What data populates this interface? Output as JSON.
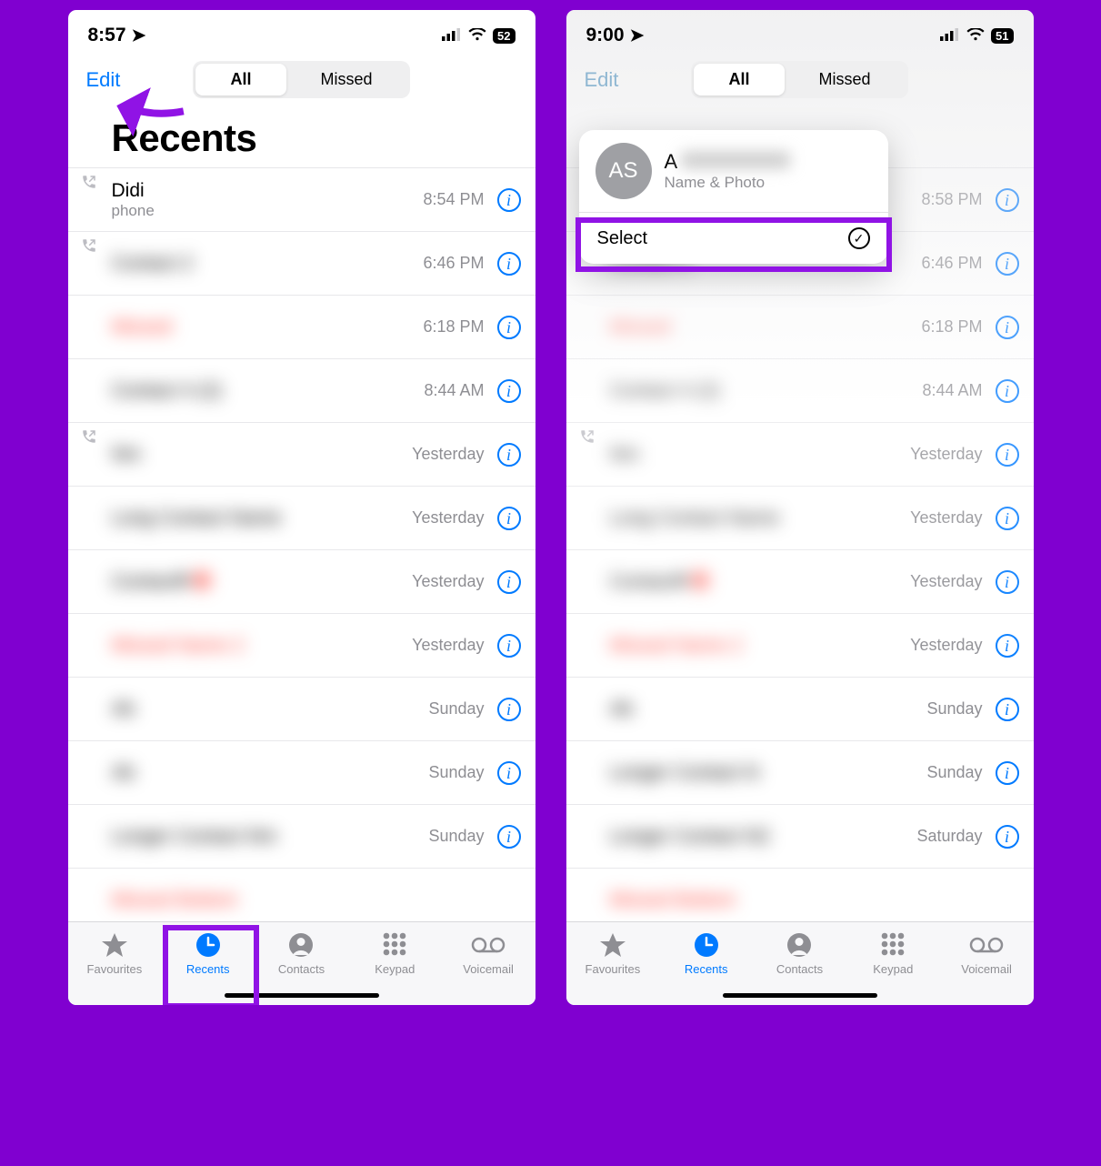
{
  "left": {
    "status": {
      "time": "8:57",
      "battery": "52"
    },
    "nav": {
      "edit": "Edit",
      "seg_all": "All",
      "seg_missed": "Missed"
    },
    "title": "Recents",
    "rows": [
      {
        "name": "Didi",
        "sub": "phone",
        "time": "8:54 PM",
        "missed": false,
        "outgoing": true,
        "blur": false
      },
      {
        "name": "Contact 2",
        "sub": "",
        "time": "6:46 PM",
        "missed": false,
        "outgoing": true,
        "blur": true
      },
      {
        "name": "Missed",
        "sub": "",
        "time": "6:18 PM",
        "missed": true,
        "outgoing": false,
        "blur": true
      },
      {
        "name": "Contact 4 (2)",
        "sub": "",
        "time": "8:44 AM",
        "missed": false,
        "outgoing": false,
        "blur": true
      },
      {
        "name": "Nm",
        "sub": "",
        "time": "Yesterday",
        "missed": false,
        "outgoing": true,
        "blur": true
      },
      {
        "name": "Long Contact Name",
        "sub": "",
        "time": "Yesterday",
        "missed": false,
        "outgoing": false,
        "blur": true
      },
      {
        "name": "ContactR",
        "sub": "",
        "time": "Yesterday",
        "missed": false,
        "outgoing": false,
        "blur": true,
        "reddot": true
      },
      {
        "name": "Missed Name 2",
        "sub": "",
        "time": "Yesterday",
        "missed": true,
        "outgoing": false,
        "blur": true
      },
      {
        "name": "Ab",
        "sub": "",
        "time": "Sunday",
        "missed": false,
        "outgoing": false,
        "blur": true
      },
      {
        "name": "Ab",
        "sub": "",
        "time": "Sunday",
        "missed": false,
        "outgoing": false,
        "blur": true
      },
      {
        "name": "Longer Contact Nm",
        "sub": "",
        "time": "Sunday",
        "missed": false,
        "outgoing": false,
        "blur": true
      },
      {
        "name": "Missed Bottom",
        "sub": "",
        "time": "",
        "missed": true,
        "outgoing": false,
        "blur": true
      }
    ],
    "tabs": {
      "fav": "Favourites",
      "rec": "Recents",
      "con": "Contacts",
      "key": "Keypad",
      "vm": "Voicemail"
    }
  },
  "right": {
    "status": {
      "time": "9:00",
      "battery": "51"
    },
    "nav": {
      "edit": "Edit",
      "seg_all": "All",
      "seg_missed": "Missed"
    },
    "popup": {
      "avatar": "AS",
      "name": "A",
      "sub": "Name & Photo",
      "action": "Select"
    },
    "rows": [
      {
        "name": "",
        "sub": "",
        "time": "8:58 PM",
        "missed": false,
        "outgoing": false,
        "blur": true
      },
      {
        "name": "Contact 2",
        "sub": "",
        "time": "6:46 PM",
        "missed": false,
        "outgoing": false,
        "blur": true
      },
      {
        "name": "Missed",
        "sub": "",
        "time": "6:18 PM",
        "missed": true,
        "outgoing": false,
        "blur": true
      },
      {
        "name": "Contact 4 (2)",
        "sub": "",
        "time": "8:44 AM",
        "missed": false,
        "outgoing": false,
        "blur": true
      },
      {
        "name": "Nm",
        "sub": "",
        "time": "Yesterday",
        "missed": false,
        "outgoing": true,
        "blur": true
      },
      {
        "name": "Long Contact Name",
        "sub": "",
        "time": "Yesterday",
        "missed": false,
        "outgoing": false,
        "blur": true
      },
      {
        "name": "ContactR",
        "sub": "",
        "time": "Yesterday",
        "missed": false,
        "outgoing": false,
        "blur": true,
        "reddot": true
      },
      {
        "name": "Missed Name 2",
        "sub": "",
        "time": "Yesterday",
        "missed": true,
        "outgoing": false,
        "blur": true
      },
      {
        "name": "Ab",
        "sub": "",
        "time": "Sunday",
        "missed": false,
        "outgoing": false,
        "blur": true
      },
      {
        "name": "Longer Contact N",
        "sub": "",
        "time": "Sunday",
        "missed": false,
        "outgoing": false,
        "blur": true
      },
      {
        "name": "Longer Contact N2",
        "sub": "",
        "time": "Saturday",
        "missed": false,
        "outgoing": false,
        "blur": true
      },
      {
        "name": "Missed Bottom",
        "sub": "",
        "time": "",
        "missed": true,
        "outgoing": false,
        "blur": true
      }
    ],
    "tabs": {
      "fav": "Favourites",
      "rec": "Recents",
      "con": "Contacts",
      "key": "Keypad",
      "vm": "Voicemail"
    }
  }
}
